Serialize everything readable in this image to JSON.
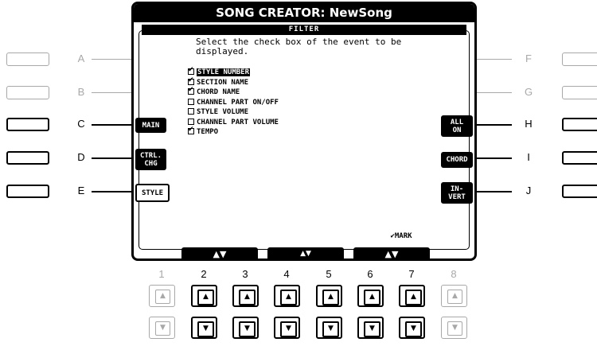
{
  "screen": {
    "title": "SONG CREATOR: NewSong",
    "tab": "FILTER",
    "instruction": "Select the check box of the event to be displayed."
  },
  "events": [
    {
      "label": "STYLE NUMBER",
      "checked": true,
      "selected": true
    },
    {
      "label": "SECTION NAME",
      "checked": true,
      "selected": false
    },
    {
      "label": "CHORD NAME",
      "checked": true,
      "selected": false
    },
    {
      "label": "CHANNEL PART ON/OFF",
      "checked": false,
      "selected": false
    },
    {
      "label": "STYLE VOLUME",
      "checked": false,
      "selected": false
    },
    {
      "label": "CHANNEL PART VOLUME",
      "checked": false,
      "selected": false
    },
    {
      "label": "TEMPO",
      "checked": true,
      "selected": false
    }
  ],
  "left_buttons": {
    "main": "MAIN",
    "ctrl_chg_line1": "CTRL.",
    "ctrl_chg_line2": "CHG",
    "style": "STYLE"
  },
  "right_buttons": {
    "all_on_line1": "ALL",
    "all_on_line2": "ON",
    "chord": "CHORD",
    "invert_line1": "IN-",
    "invert_line2": "VERT"
  },
  "bottom": {
    "tab1": "▲▼",
    "tab2": "▲▼",
    "mark": "✔MARK",
    "tab3": "▲▼"
  },
  "side_letters": {
    "left": [
      "A",
      "B",
      "C",
      "D",
      "E"
    ],
    "right": [
      "F",
      "G",
      "H",
      "I",
      "J"
    ]
  },
  "numbers": [
    "1",
    "2",
    "3",
    "4",
    "5",
    "6",
    "7",
    "8"
  ],
  "arrows": {
    "up": "▲",
    "down": "▼",
    "check": "✔"
  }
}
